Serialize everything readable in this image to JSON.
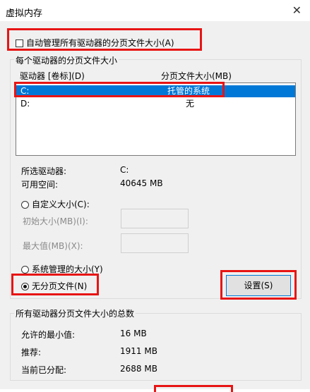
{
  "window": {
    "title": "虚拟内存",
    "close_glyph": "✕"
  },
  "auto_manage": {
    "label": "自动管理所有驱动器的分页文件大小(A)"
  },
  "per_drive": {
    "legend": "每个驱动器的分页文件大小",
    "col_drive": "驱动器 [卷标](D)",
    "col_size": "分页文件大小(MB)",
    "rows": [
      {
        "drive": "C:",
        "size": "托管的系统"
      },
      {
        "drive": "D:",
        "size": "无"
      }
    ],
    "selected_label": "所选驱动器:",
    "selected_value": "C:",
    "free_label": "可用空间:",
    "free_value": "40645 MB",
    "custom_label": "自定义大小(C):",
    "initial_label": "初始大小(MB)(I):",
    "max_label": "最大值(MB)(X):",
    "system_label": "系统管理的大小(Y)",
    "none_label": "无分页文件(N)",
    "set_label": "设置(S)"
  },
  "totals": {
    "legend": "所有驱动器分页文件大小的总数",
    "min_label": "允许的最小值:",
    "min_value": "16 MB",
    "rec_label": "推荐:",
    "rec_value": "1911 MB",
    "cur_label": "当前已分配:",
    "cur_value": "2688 MB"
  },
  "colors": {
    "highlight": "#e81414",
    "selection": "#0078d7"
  }
}
